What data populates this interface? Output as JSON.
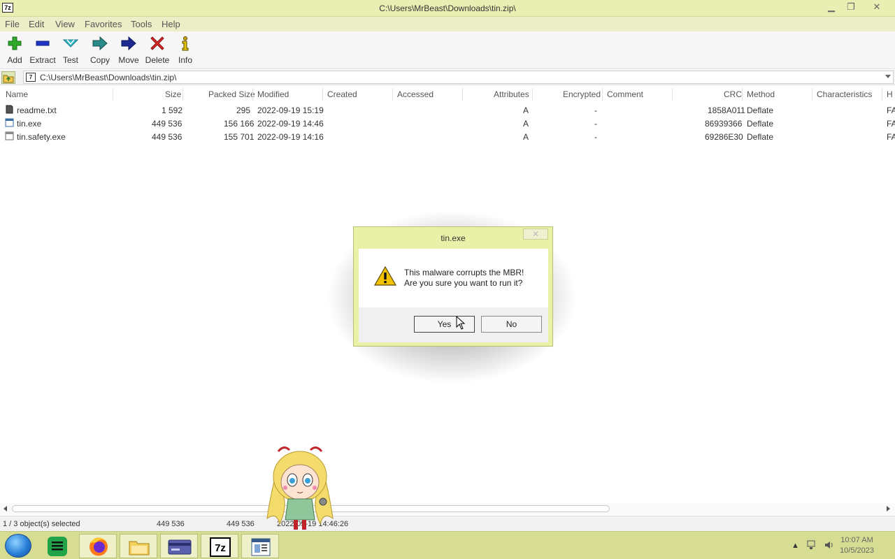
{
  "window": {
    "title": "C:\\Users\\MrBeast\\Downloads\\tin.zip\\",
    "app_icon": "7z",
    "controls": [
      "minimize",
      "restore",
      "close"
    ]
  },
  "menu": [
    "File",
    "Edit",
    "View",
    "Favorites",
    "Tools",
    "Help"
  ],
  "toolbar": [
    {
      "label": "Add",
      "icon": "plus-icon"
    },
    {
      "label": "Extract",
      "icon": "minus-icon"
    },
    {
      "label": "Test",
      "icon": "check-icon"
    },
    {
      "label": "Copy",
      "icon": "copy-arrow-icon"
    },
    {
      "label": "Move",
      "icon": "move-arrow-icon"
    },
    {
      "label": "Delete",
      "icon": "delete-x-icon"
    },
    {
      "label": "Info",
      "icon": "info-icon"
    }
  ],
  "address": {
    "path": "C:\\Users\\MrBeast\\Downloads\\tin.zip\\"
  },
  "columns": [
    "Name",
    "Size",
    "Packed Size",
    "Modified",
    "Created",
    "Accessed",
    "Attributes",
    "Encrypted",
    "Comment",
    "CRC",
    "Method",
    "Characteristics",
    "H"
  ],
  "files": [
    {
      "name": "readme.txt",
      "size": "1 592",
      "packed": "295",
      "modified": "2022-09-19 15:19",
      "attributes": "A",
      "encrypted": "-",
      "crc": "1858A011",
      "method": "Deflate",
      "host": "FA",
      "icon": "text-file-icon"
    },
    {
      "name": "tin.exe",
      "size": "449 536",
      "packed": "156 166",
      "modified": "2022-09-19 14:46",
      "attributes": "A",
      "encrypted": "-",
      "crc": "86939366",
      "method": "Deflate",
      "host": "FA",
      "icon": "exe-file-icon"
    },
    {
      "name": "tin.safety.exe",
      "size": "449 536",
      "packed": "155 701",
      "modified": "2022-09-19 14:16",
      "attributes": "A",
      "encrypted": "-",
      "crc": "69286E30",
      "method": "Deflate",
      "host": "FA",
      "icon": "exe-file-icon"
    }
  ],
  "status": {
    "selected": "1 / 3 object(s) selected",
    "size": "449 536",
    "packed": "449 536",
    "modified": "2022-09-19 14:46:26"
  },
  "dialog": {
    "title": "tin.exe",
    "close": "✕",
    "line1": "This malware corrupts the MBR!",
    "line2": "Are you sure you want to run it?",
    "yes": "Yes",
    "no": "No"
  },
  "taskbar": {
    "apps": [
      "start-orb",
      "notes-app",
      "firefox",
      "file-explorer",
      "card-app",
      "7zip",
      "document-app"
    ],
    "time": "10:07 AM",
    "date": "10/5/2023"
  },
  "colors": {
    "titlebar": "#e9eeb3",
    "taskbar": "#d6dd92",
    "dialog_frame": "#e9f0a8"
  }
}
